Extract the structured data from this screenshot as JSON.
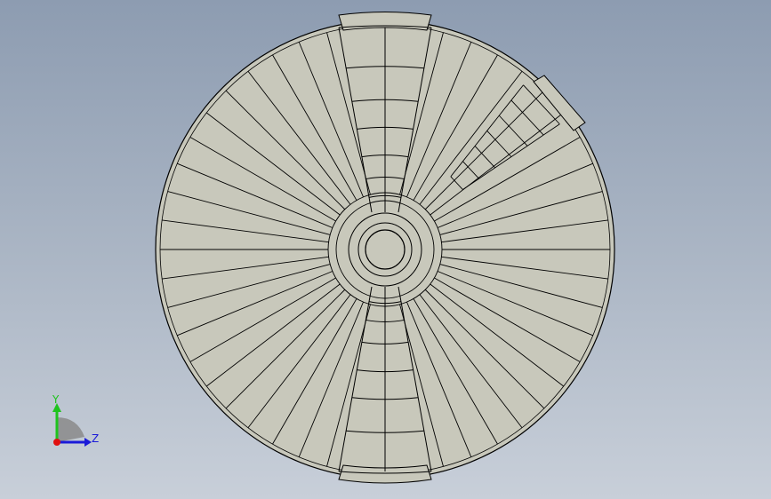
{
  "viewport": {
    "background_top": "#8d9cb1",
    "background_bottom": "#c8cfd9",
    "model_fill": "#c8c8bb",
    "edge_color": "#000000"
  },
  "model": {
    "radial_segments": 48
  },
  "triad": {
    "y_label": "Y",
    "z_label": "Z",
    "y_color": "#1ec31e",
    "z_color": "#1a1ad8",
    "x_color": "#e01010"
  }
}
